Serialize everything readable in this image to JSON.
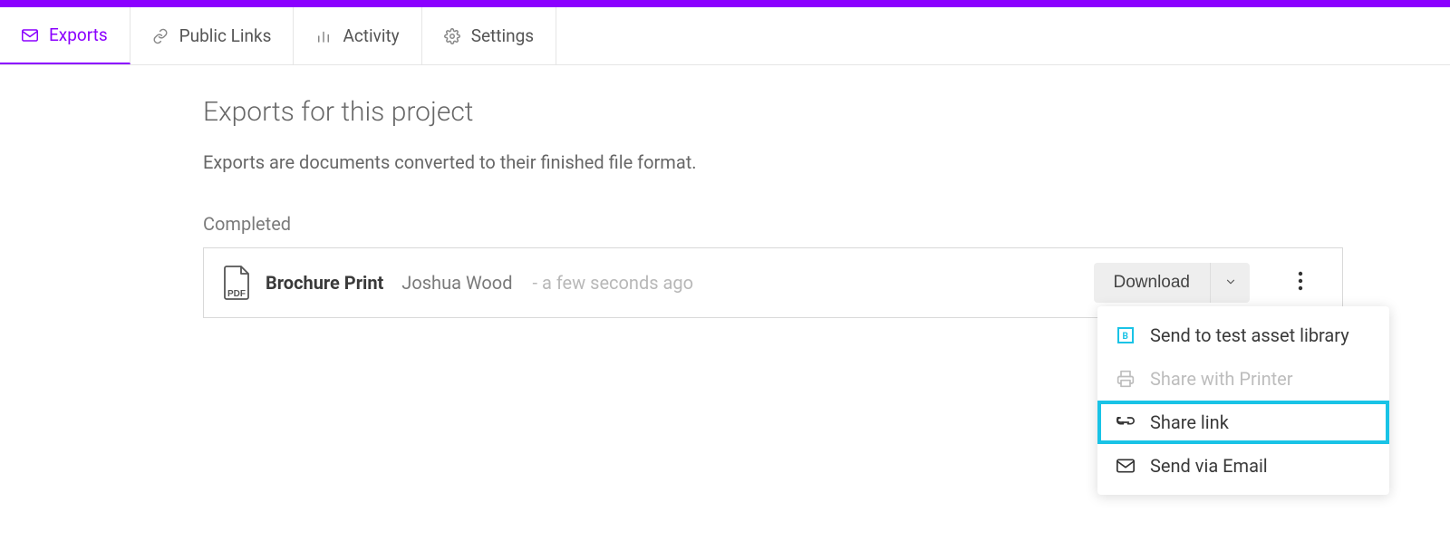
{
  "tabs": [
    {
      "label": "Exports",
      "icon": "mail-icon",
      "active": true
    },
    {
      "label": "Public Links",
      "icon": "link-icon",
      "active": false
    },
    {
      "label": "Activity",
      "icon": "bars-icon",
      "active": false
    },
    {
      "label": "Settings",
      "icon": "gear-icon",
      "active": false
    }
  ],
  "page": {
    "title": "Exports for this project",
    "subtitle": "Exports are documents converted to their finished file format.",
    "section_label": "Completed"
  },
  "export": {
    "file_type": "PDF",
    "name": "Brochure Print",
    "author": "Joshua Wood",
    "time": "- a few seconds ago",
    "download_label": "Download"
  },
  "menu": {
    "items": [
      {
        "label": "Send to test asset library",
        "icon": "brand-icon",
        "state": "normal"
      },
      {
        "label": "Share with Printer",
        "icon": "printer-icon",
        "state": "disabled"
      },
      {
        "label": "Share link",
        "icon": "link2-icon",
        "state": "highlighted"
      },
      {
        "label": "Send via Email",
        "icon": "mail-icon",
        "state": "normal"
      }
    ]
  }
}
